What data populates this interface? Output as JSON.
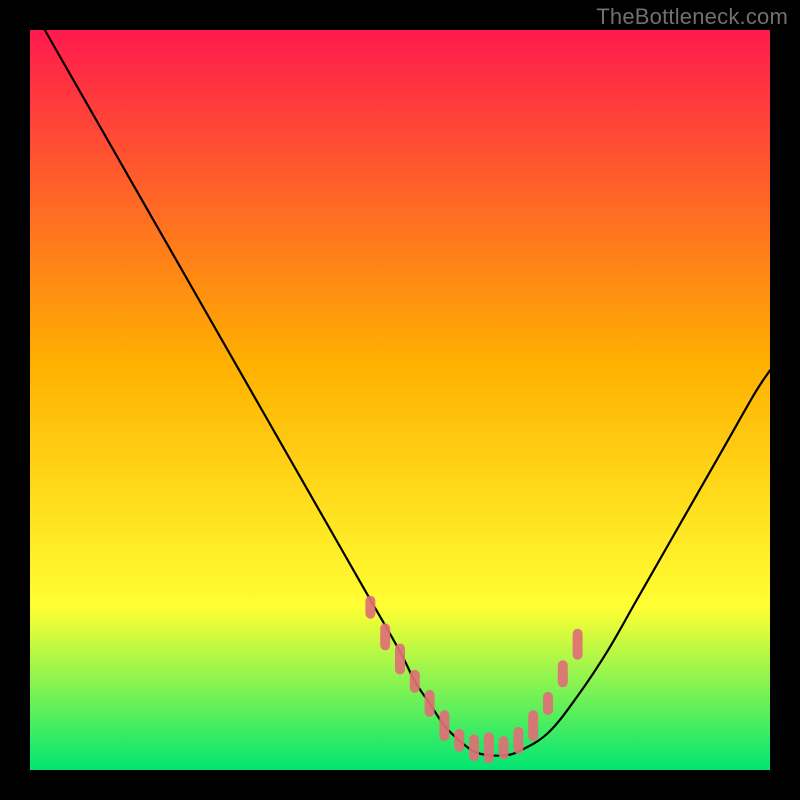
{
  "watermark": "TheBottleneck.com",
  "chart_data": {
    "type": "line",
    "title": "",
    "xlabel": "",
    "ylabel": "",
    "xlim": [
      0,
      100
    ],
    "ylim": [
      0,
      100
    ],
    "background_gradient": {
      "top": "#ff1a4d",
      "mid1": "#ffb000",
      "mid2": "#ffff33",
      "bottom": "#00e673"
    },
    "series": [
      {
        "name": "bottleneck-curve",
        "color": "#000000",
        "x": [
          2,
          6,
          10,
          14,
          18,
          22,
          26,
          30,
          34,
          38,
          42,
          46,
          50,
          52,
          54,
          56,
          58,
          60,
          62,
          64,
          66,
          70,
          74,
          78,
          82,
          86,
          90,
          94,
          98,
          100
        ],
        "y": [
          100,
          93,
          86,
          79,
          72,
          65,
          58,
          51,
          44,
          37,
          30,
          23,
          16,
          12,
          9,
          6,
          4,
          2.5,
          2,
          2,
          2.5,
          5,
          10,
          16,
          23,
          30,
          37,
          44,
          51,
          54
        ]
      }
    ],
    "marker_band": {
      "name": "optimal-range-markers",
      "color": "#e07077",
      "stroke": "#e07077",
      "x": [
        46,
        48,
        50,
        52,
        54,
        56,
        58,
        60,
        62,
        64,
        66,
        68,
        70,
        72,
        74
      ],
      "y": [
        22,
        18,
        15,
        12,
        9,
        6,
        4,
        3,
        3,
        3,
        4,
        6,
        9,
        13,
        17
      ]
    }
  }
}
